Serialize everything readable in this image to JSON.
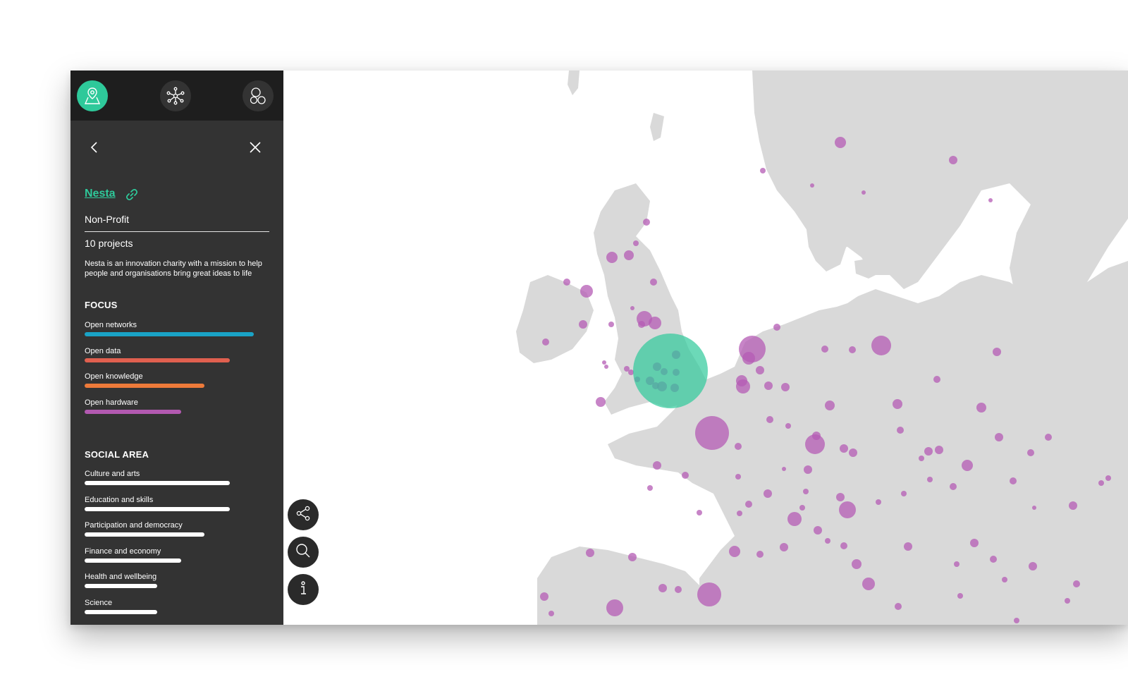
{
  "topbar": {
    "buttons": [
      {
        "icon": "map-pin-icon",
        "active": true
      },
      {
        "icon": "network-icon",
        "active": false
      },
      {
        "icon": "circles-icon",
        "active": false
      }
    ]
  },
  "panel": {
    "back_icon": "chevron-left-icon",
    "close_icon": "close-icon",
    "org_name": "Nesta",
    "link_icon": "link-icon",
    "org_type": "Non-Profit",
    "projects": "10 projects",
    "description": "Nesta is an innovation charity with a mission to help people and organisations bring great ideas to life"
  },
  "focus": {
    "title": "FOCUS",
    "items": [
      {
        "label": "Open networks",
        "value": 1.0,
        "color": "#1aa3c6"
      },
      {
        "label": "Open data",
        "value": 0.86,
        "color": "#e0604f"
      },
      {
        "label": "Open knowledge",
        "value": 0.71,
        "color": "#ee7a3a"
      },
      {
        "label": "Open hardware",
        "value": 0.57,
        "color": "#b259b0"
      }
    ]
  },
  "social": {
    "title": "SOCIAL AREA",
    "items": [
      {
        "label": "Culture and arts",
        "value": 0.86
      },
      {
        "label": "Education and skills",
        "value": 0.86
      },
      {
        "label": "Participation and democracy",
        "value": 0.71
      },
      {
        "label": "Finance and economy",
        "value": 0.57
      },
      {
        "label": "Health and wellbeing",
        "value": 0.43
      },
      {
        "label": "Science",
        "value": 0.43
      }
    ]
  },
  "map_actions": [
    {
      "icon": "share-icon"
    },
    {
      "icon": "search-icon"
    },
    {
      "icon": "info-icon"
    }
  ],
  "colors": {
    "accent": "#2ec99a",
    "bubble": "#b45bb4",
    "land": "#d9d9d9",
    "sidebar": "#333333"
  }
}
